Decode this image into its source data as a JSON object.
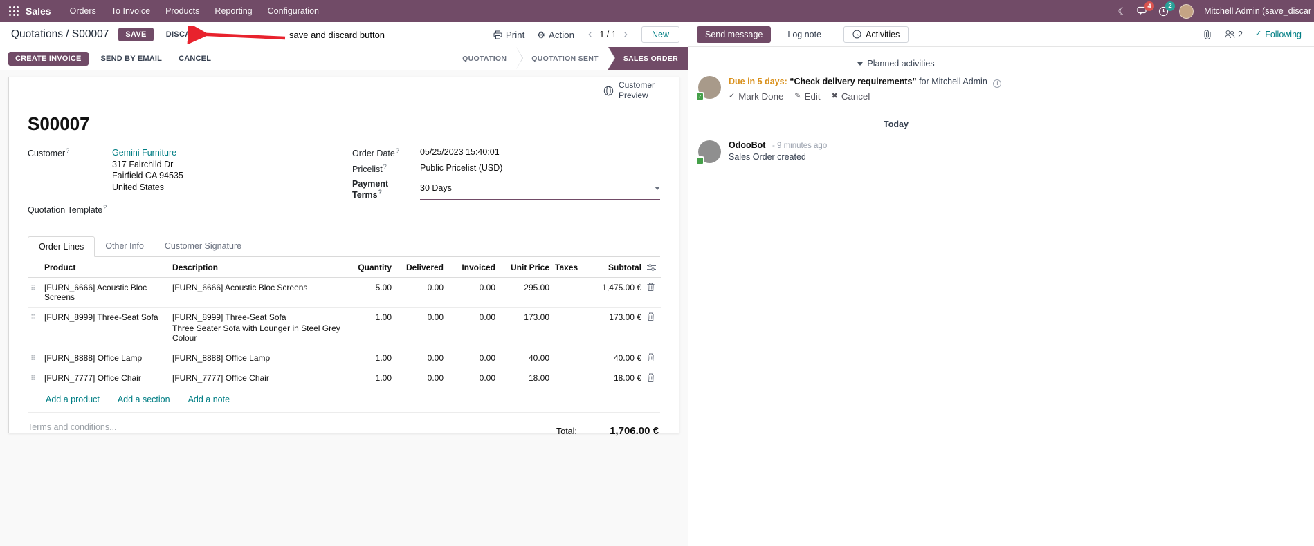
{
  "colors": {
    "brand": "#714B67",
    "link": "#017e84",
    "edited_value": "#2e7bcf",
    "due_warning": "#d9911e",
    "annotation_arrow": "#e8222d",
    "messages_badge": "#d9534f",
    "activities_badge": "#2aa198"
  },
  "topbar": {
    "app_name": "Sales",
    "menus": [
      "Orders",
      "To Invoice",
      "Products",
      "Reporting",
      "Configuration"
    ],
    "messages_badge": "4",
    "activities_badge": "2",
    "user_name": "Mitchell Admin (save_discar"
  },
  "control_panel": {
    "breadcrumb_parent": "Quotations",
    "breadcrumb_separator": "/",
    "breadcrumb_current": "S00007",
    "save_label": "SAVE",
    "discard_label": "DISCARD",
    "annotation_text": "save and discard button",
    "print_label": "Print",
    "action_label": "Action",
    "pager_value": "1 / 1",
    "new_label": "New"
  },
  "statusbar": {
    "create_invoice_label": "CREATE INVOICE",
    "send_by_email_label": "SEND BY EMAIL",
    "cancel_label": "CANCEL",
    "steps": [
      {
        "label": "QUOTATION"
      },
      {
        "label": "QUOTATION SENT"
      },
      {
        "label": "SALES ORDER"
      }
    ]
  },
  "sheet": {
    "help_marker": "?",
    "preview_button_label": "Customer Preview",
    "title": "S00007",
    "fields": {
      "customer_label": "Customer",
      "customer_value": "Gemini Furniture",
      "customer_address_1": "317 Fairchild Dr",
      "customer_address_2": "Fairfield CA 94535",
      "customer_address_3": "United States",
      "quotation_template_label": "Quotation Template",
      "order_date_label": "Order Date",
      "order_date_value": "05/25/2023 15:40:01",
      "pricelist_label": "Pricelist",
      "pricelist_value": "Public Pricelist (USD)",
      "payment_terms_label": "Payment Terms",
      "payment_terms_value": "30 Days"
    },
    "tabs": [
      {
        "label": "Order Lines"
      },
      {
        "label": "Other Info"
      },
      {
        "label": "Customer Signature"
      }
    ],
    "table": {
      "headers": [
        "Product",
        "Description",
        "Quantity",
        "Delivered",
        "Invoiced",
        "Unit Price",
        "Taxes",
        "Subtotal"
      ],
      "rows": [
        {
          "product": "[FURN_6666] Acoustic Bloc Screens",
          "description": "[FURN_6666] Acoustic Bloc Screens",
          "description2": "",
          "quantity": "5.00",
          "delivered": "0.00",
          "invoiced": "0.00",
          "unit_price": "295.00",
          "taxes": "",
          "subtotal": "1,475.00 €"
        },
        {
          "product": "[FURN_8999] Three-Seat Sofa",
          "description": "[FURN_8999] Three-Seat Sofa",
          "description2": "Three Seater Sofa with Lounger in Steel Grey Colour",
          "quantity": "1.00",
          "delivered": "0.00",
          "invoiced": "0.00",
          "unit_price": "173.00",
          "taxes": "",
          "subtotal": "173.00 €"
        },
        {
          "product": "[FURN_8888] Office Lamp",
          "description": "[FURN_8888] Office Lamp",
          "description2": "",
          "quantity": "1.00",
          "delivered": "0.00",
          "invoiced": "0.00",
          "unit_price": "40.00",
          "taxes": "",
          "subtotal": "40.00 €"
        },
        {
          "product": "[FURN_7777] Office Chair",
          "description": "[FURN_7777] Office Chair",
          "description2": "",
          "quantity": "1.00",
          "delivered": "0.00",
          "invoiced": "0.00",
          "unit_price": "18.00",
          "taxes": "",
          "subtotal": "18.00 €"
        }
      ],
      "add_product_label": "Add a product",
      "add_section_label": "Add a section",
      "add_note_label": "Add a note"
    },
    "terms_placeholder": "Terms and conditions...",
    "total_label": "Total:",
    "total_value": "1,706.00 €"
  },
  "chatter": {
    "send_message_label": "Send message",
    "log_note_label": "Log note",
    "activities_label": "Activities",
    "followers_count": "2",
    "following_label": "Following",
    "planned_activities_label": "Planned activities",
    "activity": {
      "due_text": "Due in 5 days:",
      "summary": "“Check delivery requirements”",
      "assignee_text": "for Mitchell Admin",
      "mark_done_label": "Mark Done",
      "edit_label": "Edit",
      "cancel_label": "Cancel"
    },
    "day_divider": "Today",
    "message": {
      "author": "OdooBot",
      "timestamp": "- 9 minutes ago",
      "body": "Sales Order created"
    }
  }
}
